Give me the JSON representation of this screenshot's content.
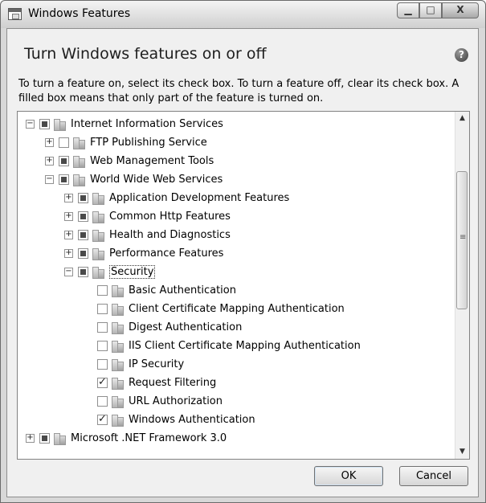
{
  "window": {
    "title": "Windows Features",
    "controls": {
      "minimize": "▁",
      "maximize": "□",
      "close": "X"
    }
  },
  "header": {
    "heading": "Turn Windows features on or off",
    "help": "?"
  },
  "description": "To turn a feature on, select its check box. To turn a feature off, clear its check box. A filled box means that only part of the feature is turned on.",
  "tree": {
    "items": [
      {
        "label": "Internet Information Services",
        "expander": "−",
        "state": "partial"
      },
      {
        "label": "FTP Publishing Service",
        "expander": "+",
        "state": "unchecked"
      },
      {
        "label": "Web Management Tools",
        "expander": "+",
        "state": "partial"
      },
      {
        "label": "World Wide Web Services",
        "expander": "−",
        "state": "partial"
      },
      {
        "label": "Application Development Features",
        "expander": "+",
        "state": "partial"
      },
      {
        "label": "Common Http Features",
        "expander": "+",
        "state": "partial"
      },
      {
        "label": "Health and Diagnostics",
        "expander": "+",
        "state": "partial"
      },
      {
        "label": "Performance Features",
        "expander": "+",
        "state": "partial"
      },
      {
        "label": "Security",
        "expander": "−",
        "state": "partial",
        "selected": true
      },
      {
        "label": "Basic Authentication",
        "expander": "",
        "state": "unchecked"
      },
      {
        "label": "Client Certificate Mapping Authentication",
        "expander": "",
        "state": "unchecked"
      },
      {
        "label": "Digest Authentication",
        "expander": "",
        "state": "unchecked"
      },
      {
        "label": "IIS Client Certificate Mapping Authentication",
        "expander": "",
        "state": "unchecked"
      },
      {
        "label": "IP Security",
        "expander": "",
        "state": "unchecked"
      },
      {
        "label": "Request Filtering",
        "expander": "",
        "state": "checked"
      },
      {
        "label": "URL Authorization",
        "expander": "",
        "state": "unchecked"
      },
      {
        "label": "Windows Authentication",
        "expander": "",
        "state": "checked"
      },
      {
        "label": "Microsoft .NET Framework 3.0",
        "expander": "+",
        "state": "partial"
      }
    ]
  },
  "buttons": {
    "ok": "OK",
    "cancel": "Cancel"
  }
}
